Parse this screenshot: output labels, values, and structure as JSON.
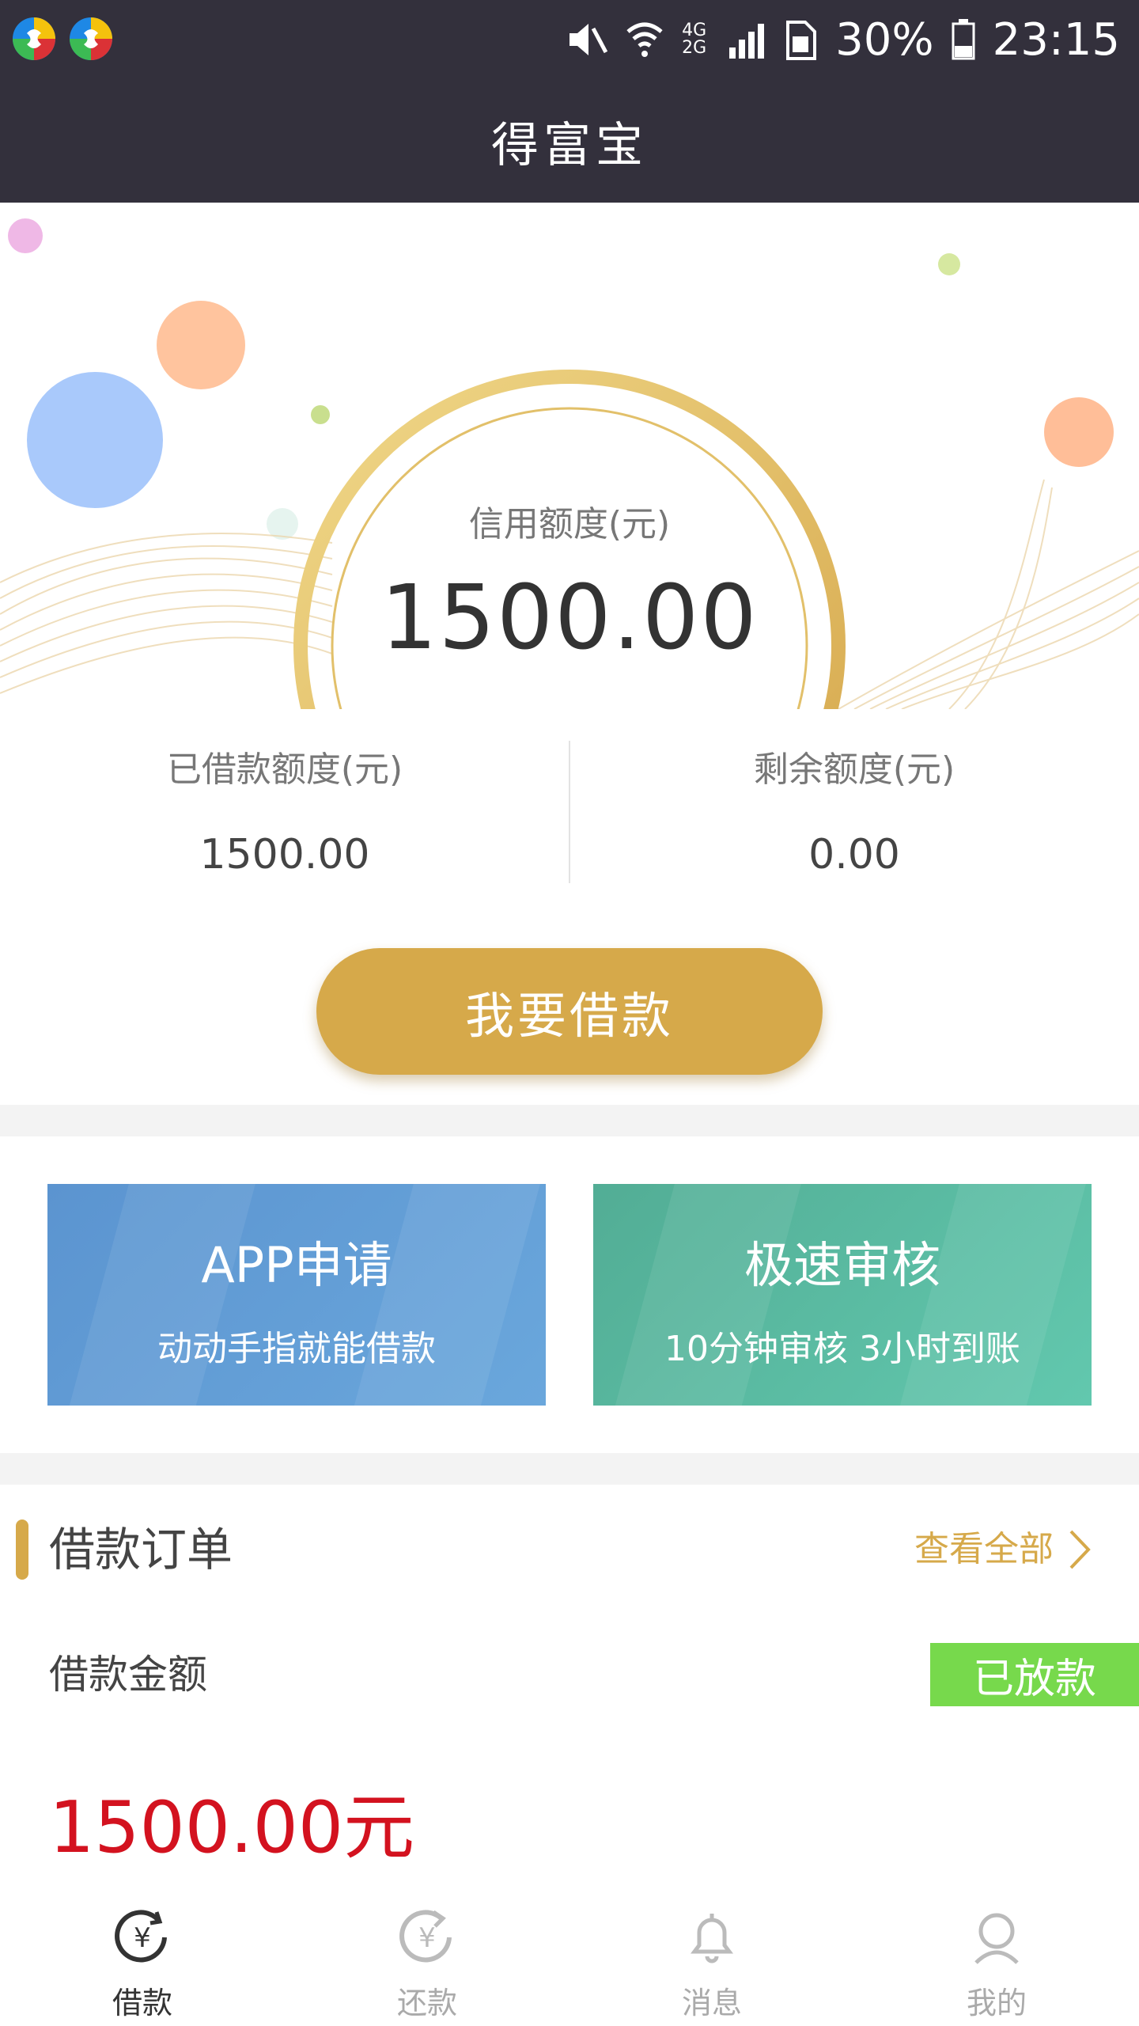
{
  "status_bar": {
    "battery": "30%",
    "time": "23:15",
    "network": "4G 2G",
    "icons": [
      "app-badge-icon",
      "app-badge-icon",
      "mute-icon",
      "wifi-icon",
      "signal-icon",
      "sim-icon",
      "battery-icon"
    ]
  },
  "header": {
    "title": "得富宝"
  },
  "credit": {
    "label": "信用额度(元)",
    "value": "1500.00"
  },
  "stats": {
    "borrowed_label": "已借款额度(元)",
    "borrowed_value": "1500.00",
    "remaining_label": "剩余额度(元)",
    "remaining_value": "0.00"
  },
  "borrow_button": {
    "label": "我要借款"
  },
  "features": [
    {
      "title": "APP申请",
      "subtitle": "动动手指就能借款",
      "color": "#5a9bd4"
    },
    {
      "title": "极速审核",
      "subtitle": "10分钟审核 3小时到账",
      "color": "#5bbba0"
    }
  ],
  "orders": {
    "section_title": "借款订单",
    "view_all": "查看全部",
    "amount_label": "借款金额",
    "status": "已放款",
    "amount_value": "1500.00元"
  },
  "tabs": [
    {
      "label": "借款",
      "icon": "loan-icon",
      "active": true
    },
    {
      "label": "还款",
      "icon": "repay-icon",
      "active": false
    },
    {
      "label": "消息",
      "icon": "bell-icon",
      "active": false
    },
    {
      "label": "我的",
      "icon": "user-icon",
      "active": false
    }
  ],
  "colors": {
    "header_bg": "#33303c",
    "accent_gold": "#d6a94a",
    "amount_red": "#d3121f",
    "status_green": "#77d94c"
  }
}
